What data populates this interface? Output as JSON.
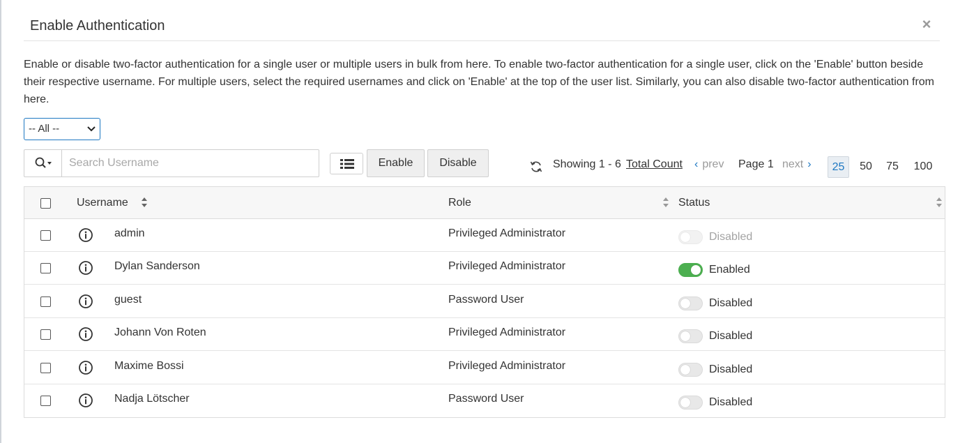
{
  "dialog": {
    "title": "Enable Authentication",
    "close_glyph": "×",
    "description": "Enable or disable two-factor authentication for a single user or multiple users in bulk from here. To enable two-factor authentication for a single user, click on the 'Enable' button beside their respective username. For multiple users, select the required usernames and click on 'Enable' at the top of the user list. Similarly, you can also disable two-factor authentication from here."
  },
  "filter": {
    "selected": "-- All --"
  },
  "search": {
    "placeholder": "Search Username"
  },
  "toolbar": {
    "enable_label": "Enable",
    "disable_label": "Disable"
  },
  "pagination": {
    "showing": "Showing 1 - 6",
    "total_count": "Total Count",
    "prev": "prev",
    "page": "Page 1",
    "next": "next",
    "page_sizes": [
      "25",
      "50",
      "75",
      "100"
    ],
    "selected_page_size": "25"
  },
  "table": {
    "columns": {
      "username": "Username",
      "role": "Role",
      "status": "Status"
    },
    "rows": [
      {
        "username": "admin",
        "role": "Privileged Administrator",
        "status": "Disabled",
        "enabled": false,
        "locked": true
      },
      {
        "username": "Dylan Sanderson",
        "role": "Privileged Administrator",
        "status": "Enabled",
        "enabled": true,
        "locked": false
      },
      {
        "username": "guest",
        "role": "Password User",
        "status": "Disabled",
        "enabled": false,
        "locked": false
      },
      {
        "username": "Johann Von Roten",
        "role": "Privileged Administrator",
        "status": "Disabled",
        "enabled": false,
        "locked": false
      },
      {
        "username": "Maxime Bossi",
        "role": "Privileged Administrator",
        "status": "Disabled",
        "enabled": false,
        "locked": false
      },
      {
        "username": "Nadja Lötscher",
        "role": "Password User",
        "status": "Disabled",
        "enabled": false,
        "locked": false
      }
    ]
  },
  "colors": {
    "accent": "#1e78c2",
    "toggle_on": "#4caf50"
  }
}
